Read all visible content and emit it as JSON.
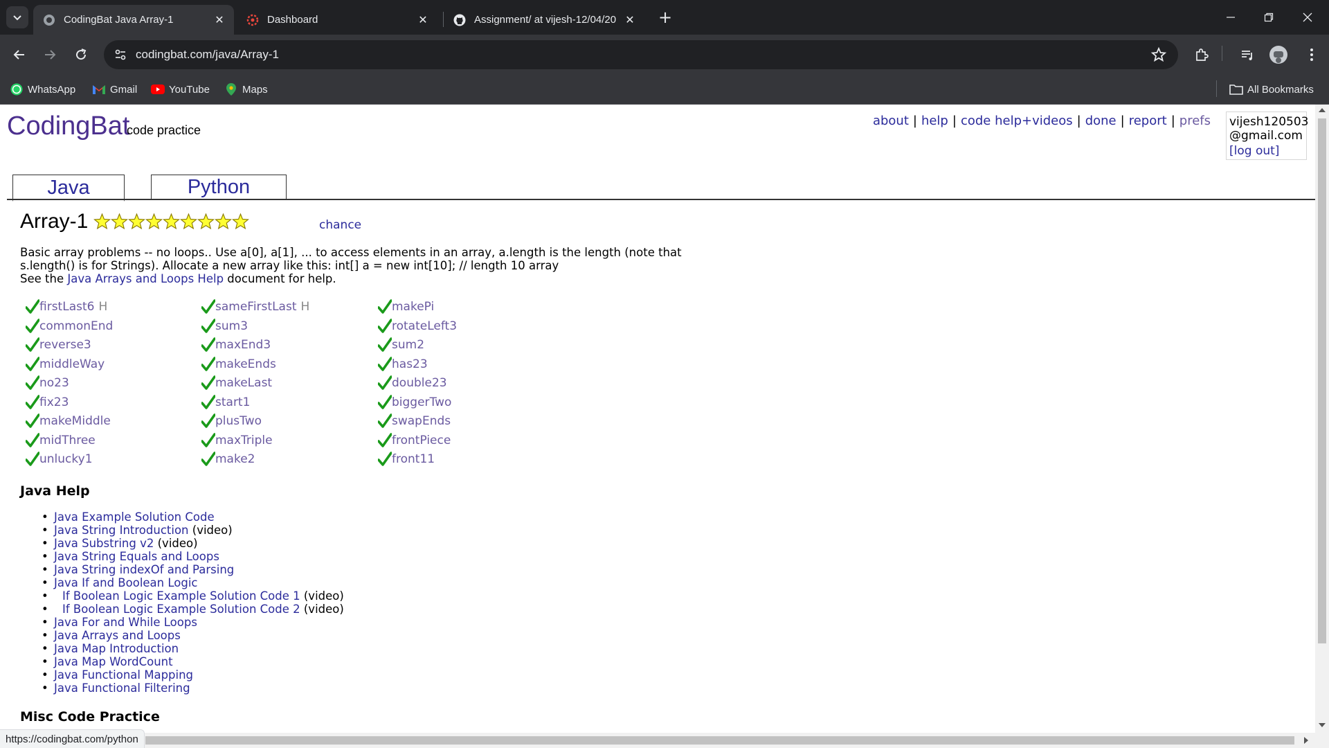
{
  "browser": {
    "tabs": [
      {
        "title": "CodingBat Java Array-1",
        "active": true,
        "icon": "codingbat-favicon"
      },
      {
        "title": "Dashboard",
        "active": false,
        "icon": "dashboard-favicon"
      },
      {
        "title": "Assignment/ at vijesh-12/04/20",
        "active": false,
        "icon": "github-icon"
      }
    ],
    "url": "codingbat.com/java/Array-1",
    "bookmarks": [
      {
        "label": "WhatsApp",
        "icon": "whatsapp-icon",
        "color": "#25d366"
      },
      {
        "label": "Gmail",
        "icon": "gmail-icon",
        "color": "#ea4335"
      },
      {
        "label": "YouTube",
        "icon": "youtube-icon",
        "color": "#ff0000"
      },
      {
        "label": "Maps",
        "icon": "maps-icon",
        "color": "#34a853"
      }
    ],
    "all_bookmarks": "All Bookmarks",
    "status_url": "https://codingbat.com/python"
  },
  "site": {
    "logo": "CodingBat",
    "tagline": "code practice",
    "toplinks": [
      "about",
      "help",
      "code help+videos",
      "done",
      "report",
      "prefs"
    ],
    "user": {
      "line1": "vijesh120503",
      "line2": "@gmail.com",
      "logout": "[log out]"
    },
    "lang_tabs": [
      "Java",
      "Python"
    ]
  },
  "section": {
    "title": "Array-1",
    "stars": 9,
    "chance": "chance",
    "desc_line1": "Basic array problems -- no loops.. Use a[0], a[1], ... to access elements in an array, a.length is the length (note that",
    "desc_line2": "s.length() is for Strings). Allocate a new array like this: int[] a = new int[10]; // length 10 array",
    "desc_see": "See the ",
    "desc_link": "Java Arrays and Loops Help",
    "desc_after": " document for help."
  },
  "problems": {
    "col1": [
      "firstLast6",
      "commonEnd",
      "reverse3",
      "middleWay",
      "no23",
      "fix23",
      "makeMiddle",
      "midThree",
      "unlucky1"
    ],
    "col2": [
      "sameFirstLast",
      "sum3",
      "maxEnd3",
      "makeEnds",
      "makeLast",
      "start1",
      "plusTwo",
      "maxTriple",
      "make2"
    ],
    "col3": [
      "makePi",
      "rotateLeft3",
      "sum2",
      "has23",
      "double23",
      "biggerTwo",
      "swapEnds",
      "frontPiece",
      "front11"
    ],
    "hint": "H",
    "check_color": "#1a9a1a"
  },
  "help": {
    "title": "Java Help",
    "items": [
      {
        "link": "Java Example Solution Code",
        "suffix": ""
      },
      {
        "link": "Java String Introduction",
        "suffix": " (video)"
      },
      {
        "link": "Java Substring v2",
        "suffix": " (video)"
      },
      {
        "link": "Java String Equals and Loops",
        "suffix": ""
      },
      {
        "link": "Java String indexOf and Parsing",
        "suffix": ""
      },
      {
        "link": "Java If and Boolean Logic",
        "suffix": ""
      },
      {
        "link": "If Boolean Logic Example Solution Code 1",
        "suffix": " (video)"
      },
      {
        "link": "If Boolean Logic Example Solution Code 2",
        "suffix": " (video)"
      },
      {
        "link": "Java For and While Loops",
        "suffix": ""
      },
      {
        "link": "Java Arrays and Loops",
        "suffix": ""
      },
      {
        "link": "Java Map Introduction",
        "suffix": ""
      },
      {
        "link": "Java Map WordCount",
        "suffix": ""
      },
      {
        "link": "Java Functional Mapping",
        "suffix": ""
      },
      {
        "link": "Java Functional Filtering",
        "suffix": ""
      }
    ]
  },
  "misc": {
    "title": "Misc Code Practice"
  }
}
